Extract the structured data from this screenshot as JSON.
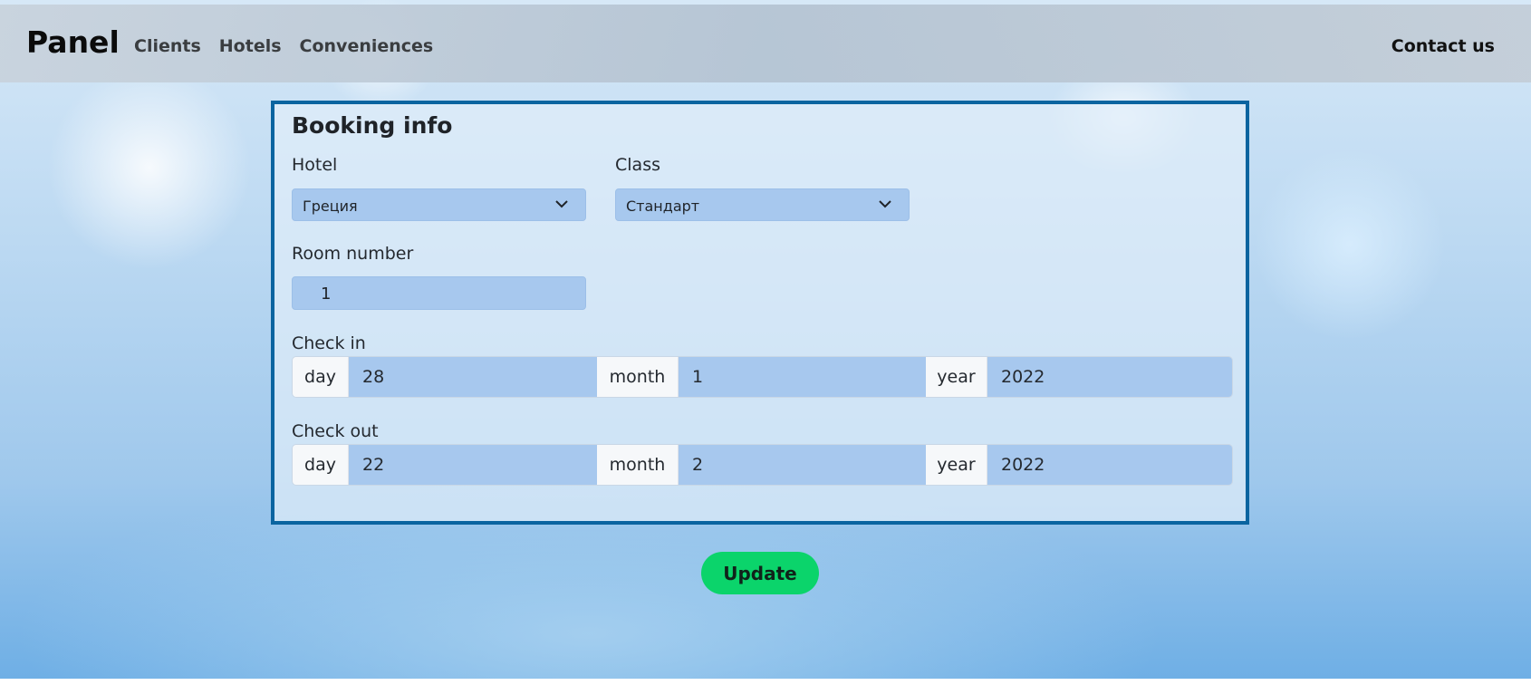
{
  "navbar": {
    "brand": "Panel",
    "links": [
      "Clients",
      "Hotels",
      "Conveniences"
    ],
    "contact": "Contact us"
  },
  "booking": {
    "title": "Booking info",
    "hotel": {
      "label": "Hotel",
      "value": "Греция"
    },
    "class": {
      "label": "Class",
      "value": "Стандарт"
    },
    "room": {
      "label": "Room number",
      "value": "1"
    },
    "check_in": {
      "label": "Check in",
      "day_label": "day",
      "day": "28",
      "month_label": "month",
      "month": "1",
      "year_label": "year",
      "year": "2022"
    },
    "check_out": {
      "label": "Check out",
      "day_label": "day",
      "day": "22",
      "month_label": "month",
      "month": "2",
      "year_label": "year",
      "year": "2022"
    }
  },
  "actions": {
    "update": "Update"
  },
  "colors": {
    "card_border": "#0a64a0",
    "field_bg": "#a7c8ee",
    "update_bg": "#0bd46b"
  }
}
